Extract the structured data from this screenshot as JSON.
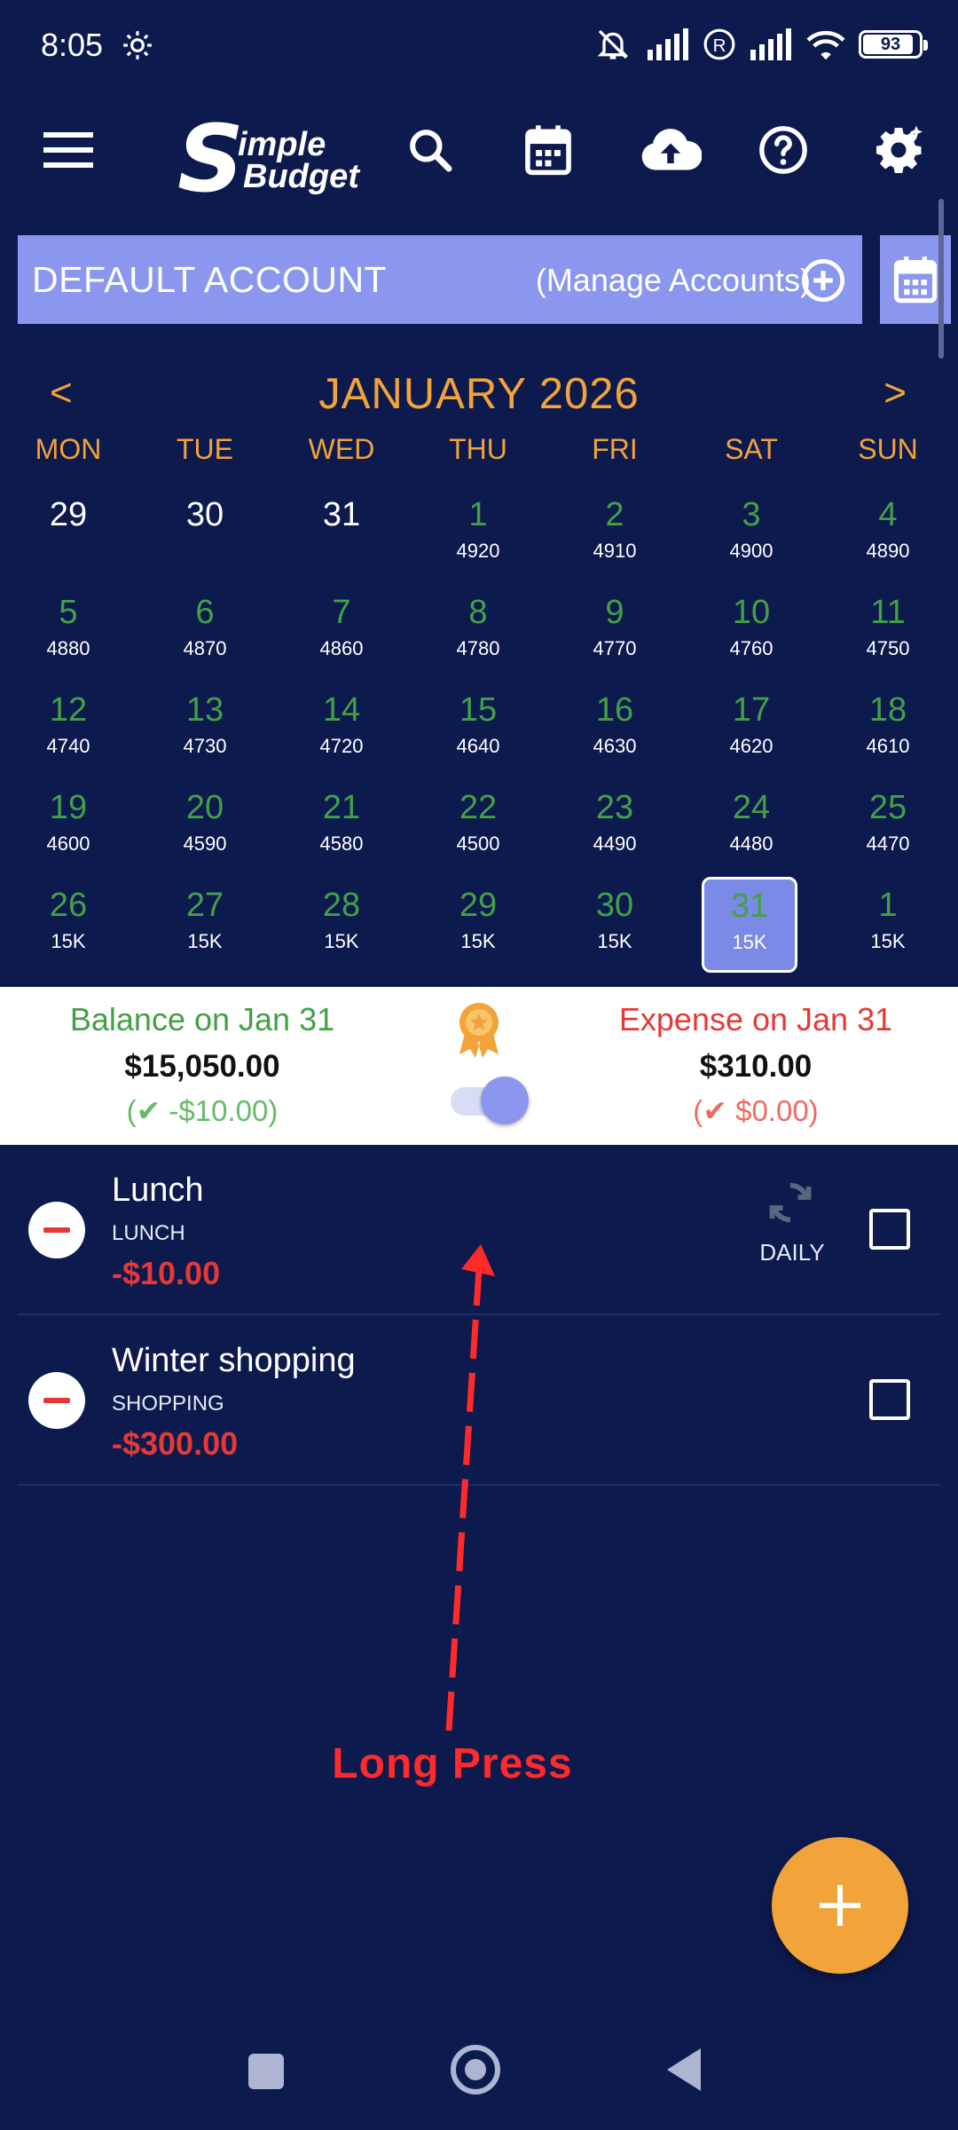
{
  "status_bar": {
    "time": "8:05",
    "battery": "93"
  },
  "app_bar": {
    "logo_letter": "S",
    "logo_word1": "imple",
    "logo_word2": "Budget"
  },
  "account": {
    "name": "DEFAULT ACCOUNT",
    "manage_label": "(Manage Accounts)"
  },
  "calendar": {
    "prev": "<",
    "next": ">",
    "month_title": "JANUARY 2026",
    "weekdays": [
      "MON",
      "TUE",
      "WED",
      "THU",
      "FRI",
      "SAT",
      "SUN"
    ],
    "weeks": [
      [
        {
          "d": "29",
          "v": ""
        },
        {
          "d": "30",
          "v": ""
        },
        {
          "d": "31",
          "v": ""
        },
        {
          "d": "1",
          "v": "4920"
        },
        {
          "d": "2",
          "v": "4910"
        },
        {
          "d": "3",
          "v": "4900"
        },
        {
          "d": "4",
          "v": "4890"
        }
      ],
      [
        {
          "d": "5",
          "v": "4880"
        },
        {
          "d": "6",
          "v": "4870"
        },
        {
          "d": "7",
          "v": "4860"
        },
        {
          "d": "8",
          "v": "4780"
        },
        {
          "d": "9",
          "v": "4770"
        },
        {
          "d": "10",
          "v": "4760"
        },
        {
          "d": "11",
          "v": "4750"
        }
      ],
      [
        {
          "d": "12",
          "v": "4740"
        },
        {
          "d": "13",
          "v": "4730"
        },
        {
          "d": "14",
          "v": "4720"
        },
        {
          "d": "15",
          "v": "4640"
        },
        {
          "d": "16",
          "v": "4630"
        },
        {
          "d": "17",
          "v": "4620"
        },
        {
          "d": "18",
          "v": "4610"
        }
      ],
      [
        {
          "d": "19",
          "v": "4600"
        },
        {
          "d": "20",
          "v": "4590"
        },
        {
          "d": "21",
          "v": "4580"
        },
        {
          "d": "22",
          "v": "4500"
        },
        {
          "d": "23",
          "v": "4490"
        },
        {
          "d": "24",
          "v": "4480"
        },
        {
          "d": "25",
          "v": "4470"
        }
      ],
      [
        {
          "d": "26",
          "v": "15K"
        },
        {
          "d": "27",
          "v": "15K"
        },
        {
          "d": "28",
          "v": "15K"
        },
        {
          "d": "29",
          "v": "15K"
        },
        {
          "d": "30",
          "v": "15K"
        },
        {
          "d": "31",
          "v": "15K"
        },
        {
          "d": "1",
          "v": "15K"
        }
      ]
    ],
    "selected": "31"
  },
  "summary": {
    "balance_title": "Balance on Jan 31",
    "balance_amount": "$15,050.00",
    "balance_diff": "(✔ -$10.00)",
    "expense_title": "Expense on Jan 31",
    "expense_amount": "$310.00",
    "expense_diff": "(✔ $0.00)"
  },
  "transactions": [
    {
      "title": "Lunch",
      "category": "LUNCH",
      "amount": "-$10.00",
      "repeat": "DAILY"
    },
    {
      "title": "Winter shopping",
      "category": "SHOPPING",
      "amount": "-$300.00",
      "repeat": ""
    }
  ],
  "annotation": {
    "text": "Long Press"
  },
  "colors": {
    "background": "#0d1a4e",
    "accent": "#f2a33a",
    "account_bar": "#8b97ee",
    "positive": "#43a047",
    "negative": "#e53935"
  }
}
